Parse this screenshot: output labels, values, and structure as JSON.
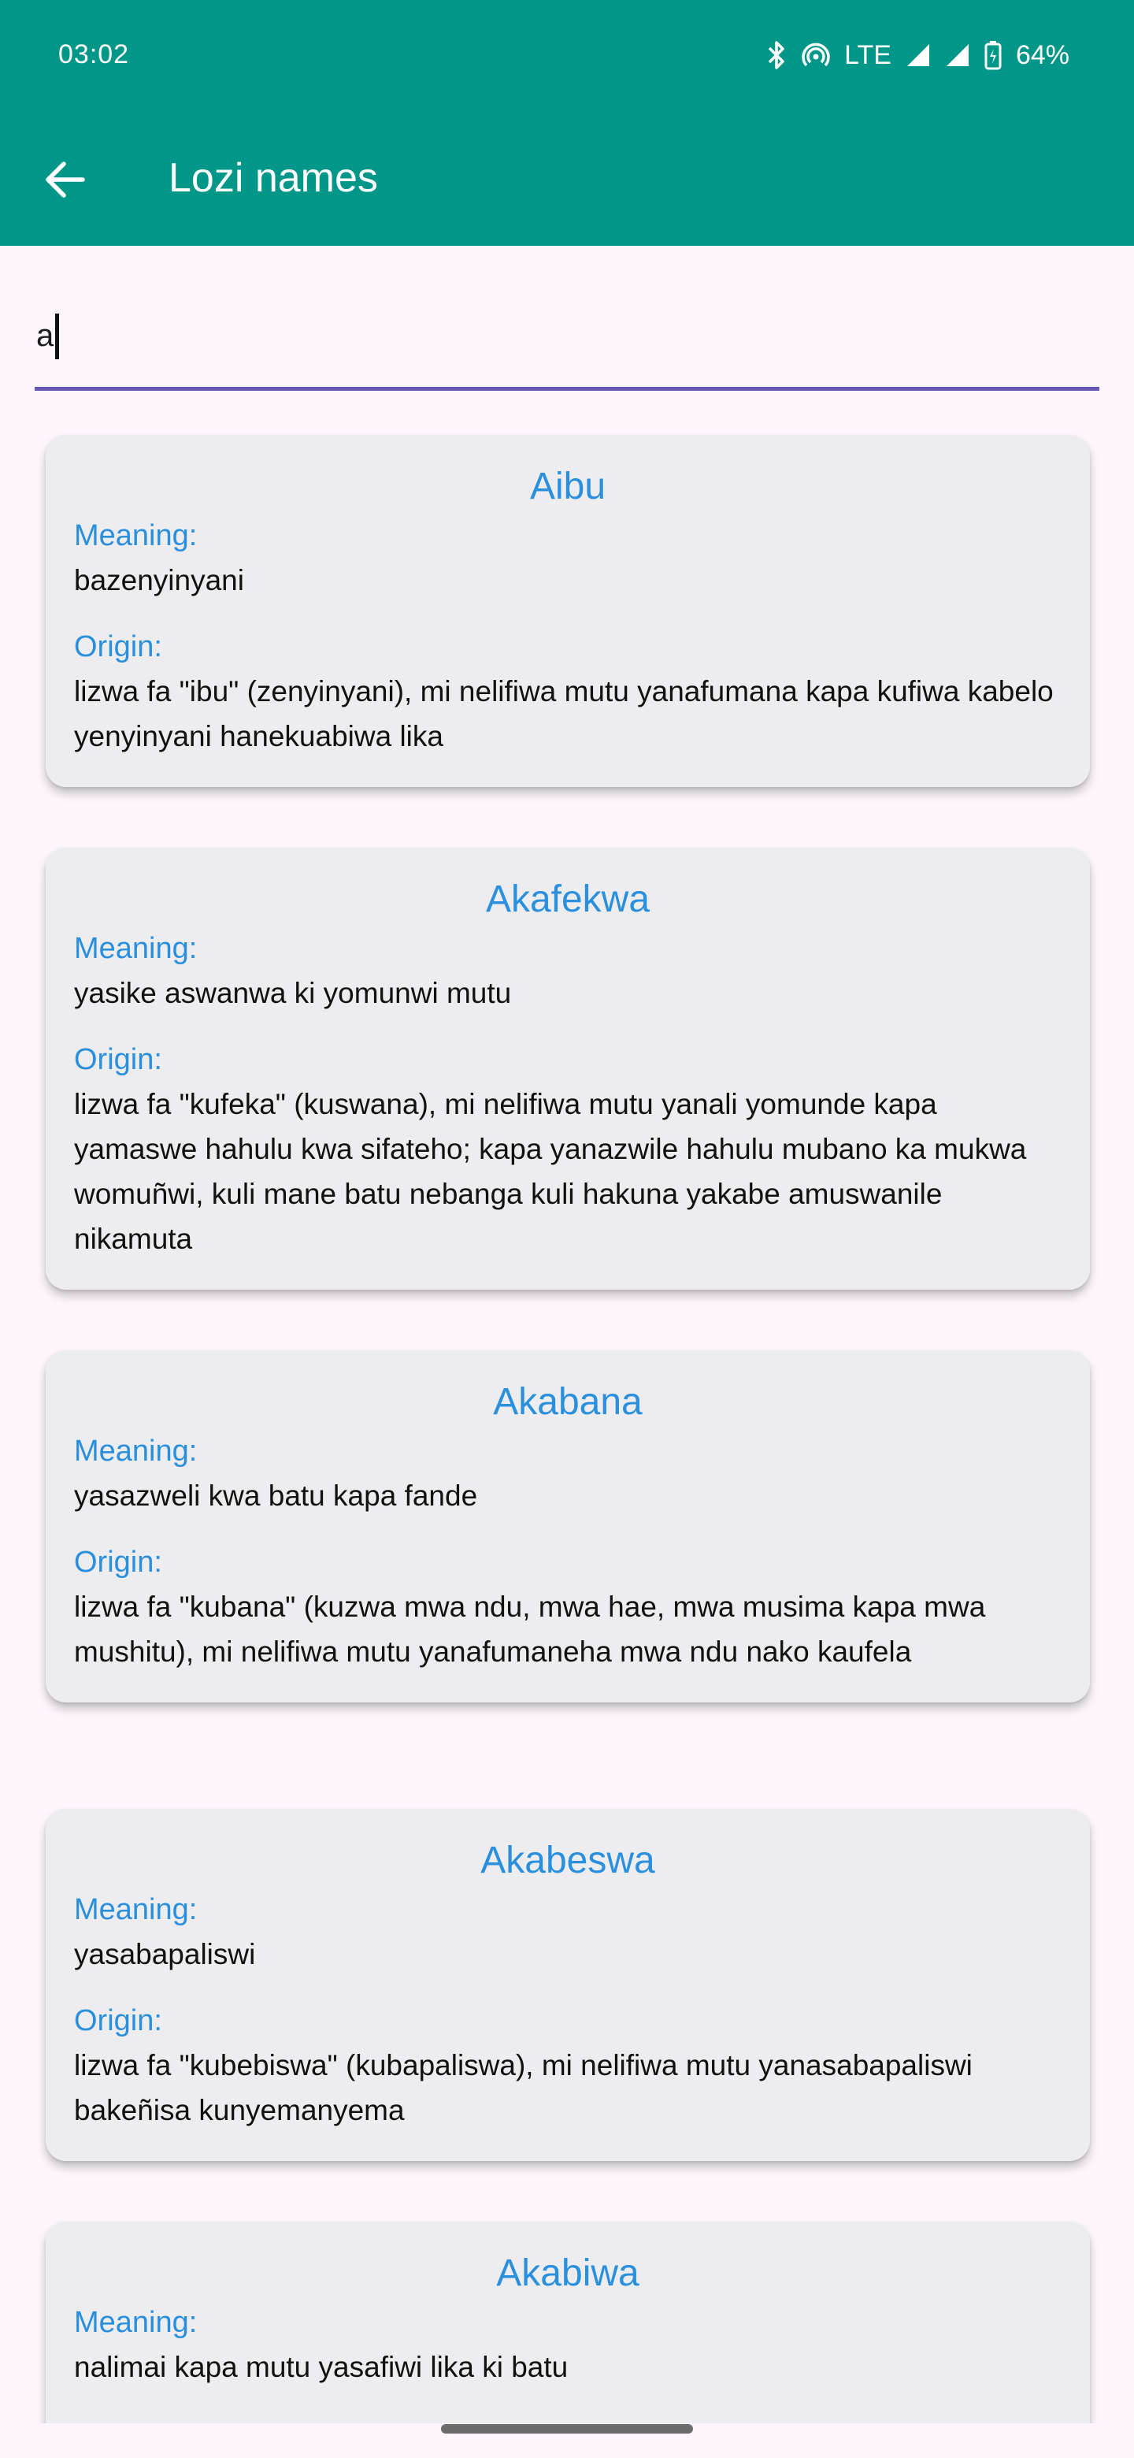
{
  "status_bar": {
    "time": "03:02",
    "network": "LTE",
    "battery": "64%",
    "icons": [
      "bluetooth-icon",
      "hotspot-icon",
      "signal-icon",
      "signal-icon",
      "battery-icon"
    ]
  },
  "toolbar": {
    "title": "Lozi names",
    "back_icon": "arrow-back-icon"
  },
  "search": {
    "value": "a"
  },
  "colors": {
    "app_bar": "#009688",
    "accent": "#2a8fdc",
    "underline": "#6755b3",
    "card_bg": "#ededf0"
  },
  "cards": [
    {
      "name": "Aibu",
      "meaning_label": "Meaning:",
      "meaning": "bazenyinyani",
      "origin_label": "Origin:",
      "origin": "lizwa fa \"ibu\" (zenyinyani), mi nelifiwa mutu yanafumana kapa kufiwa kabelo yenyinyani hanekuabiwa lika"
    },
    {
      "name": "Akafekwa",
      "meaning_label": "Meaning:",
      "meaning": "yasike aswanwa ki yomunwi mutu",
      "origin_label": "Origin:",
      "origin": "lizwa fa \"kufeka\" (kuswana), mi nelifiwa mutu yanali yomunde kapa yamaswe hahulu kwa sifateho; kapa yanazwile hahulu mubano ka mukwa womuñwi, kuli mane batu nebanga kuli hakuna yakabe amuswanile nikamuta"
    },
    {
      "name": "Akabana",
      "meaning_label": "Meaning:",
      "meaning": "yasazweli kwa batu kapa fande",
      "origin_label": "Origin:",
      "origin": "lizwa fa \"kubana\" (kuzwa mwa ndu, mwa hae, mwa musima kapa mwa mushitu), mi nelifiwa mutu yanafumaneha mwa ndu nako kaufela"
    },
    {
      "name": "Akabeswa",
      "meaning_label": "Meaning:",
      "meaning": "yasabapaliswi",
      "origin_label": "Origin:",
      "origin": "lizwa fa \"kubebiswa\" (kubapaliswa), mi nelifiwa mutu yanasabapaliswi bakeñisa kunyemanyema"
    },
    {
      "name": "Akabiwa",
      "meaning_label": "Meaning:",
      "meaning": "nalimai kapa mutu yasafiwi lika ki batu",
      "origin_label": "",
      "origin": ""
    }
  ]
}
